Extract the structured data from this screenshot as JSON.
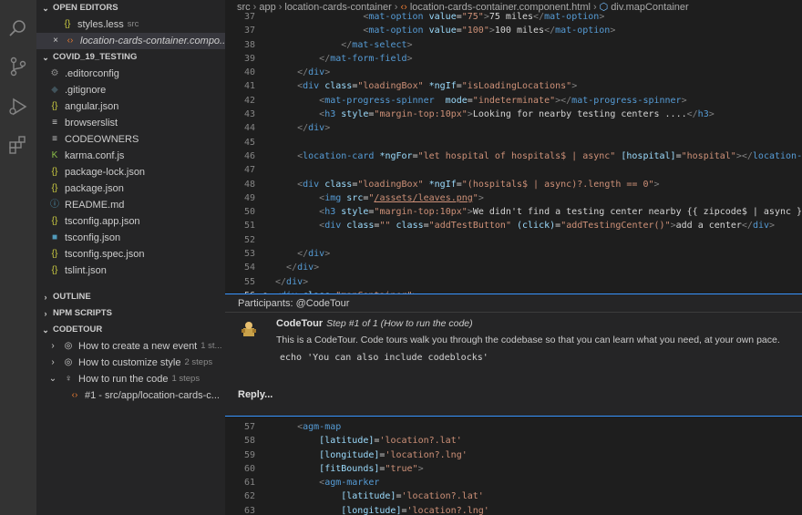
{
  "sidebar": {
    "open_editors": {
      "header": "OPEN EDITORS",
      "items": [
        {
          "name": "styles.less",
          "hint": "src",
          "icon": "braces-icon"
        },
        {
          "name": "location-cards-container.compo...",
          "hint": "",
          "icon": "html-icon"
        }
      ]
    },
    "project": {
      "header": "COVID_19_TESTING",
      "files": [
        {
          "name": ".editorconfig",
          "icon": "gear-icon",
          "glyph": "⚙",
          "color": "#8b8b8b"
        },
        {
          "name": ".gitignore",
          "icon": "git-icon",
          "glyph": "◆",
          "color": "#41535b"
        },
        {
          "name": "angular.json",
          "icon": "json-icon",
          "glyph": "{}",
          "color": "#cbcb41"
        },
        {
          "name": "browserslist",
          "icon": "lines-icon",
          "glyph": "≡",
          "color": "#cccccc"
        },
        {
          "name": "CODEOWNERS",
          "icon": "lines-icon",
          "glyph": "≡",
          "color": "#cccccc"
        },
        {
          "name": "karma.conf.js",
          "icon": "karma-icon",
          "glyph": "K",
          "color": "#8dc149"
        },
        {
          "name": "package-lock.json",
          "icon": "json-icon",
          "glyph": "{}",
          "color": "#cbcb41"
        },
        {
          "name": "package.json",
          "icon": "json-icon",
          "glyph": "{}",
          "color": "#cbcb41"
        },
        {
          "name": "README.md",
          "icon": "info-icon",
          "glyph": "ⓘ",
          "color": "#519aba"
        },
        {
          "name": "tsconfig.app.json",
          "icon": "json-icon",
          "glyph": "{}",
          "color": "#cbcb41"
        },
        {
          "name": "tsconfig.json",
          "icon": "ts-icon",
          "glyph": "■",
          "color": "#519aba"
        },
        {
          "name": "tsconfig.spec.json",
          "icon": "json-icon",
          "glyph": "{}",
          "color": "#cbcb41"
        },
        {
          "name": "tslint.json",
          "icon": "json-icon",
          "glyph": "{}",
          "color": "#cbcb41"
        }
      ]
    },
    "outline_header": "OUTLINE",
    "npm_header": "NPM SCRIPTS",
    "codetour": {
      "header": "CODETOUR",
      "tours": [
        {
          "title": "How to create a new event",
          "hint": "1 st..."
        },
        {
          "title": "How to customize style",
          "hint": "2 steps"
        },
        {
          "title": "How to run the code",
          "hint": "1 steps"
        }
      ],
      "step": "#1 - src/app/location-cards-c..."
    }
  },
  "breadcrumb": [
    "src",
    "app",
    "location-cards-container",
    "location-cards-container.component.html",
    "div.mapContainer"
  ],
  "thread": {
    "participants": "Participants: @CodeTour",
    "author": "CodeTour",
    "step": "Step #1 of 1 (How to run the code)",
    "text": "This is a CodeTour. Code tours walk you through the codebase so that you can learn what you need, at your own pace.",
    "code": "echo 'You can also include codeblocks'",
    "reply": "Reply..."
  },
  "colors": {
    "accent": "#3794ff",
    "sidebar": "#252526",
    "editor": "#1e1e1e"
  }
}
